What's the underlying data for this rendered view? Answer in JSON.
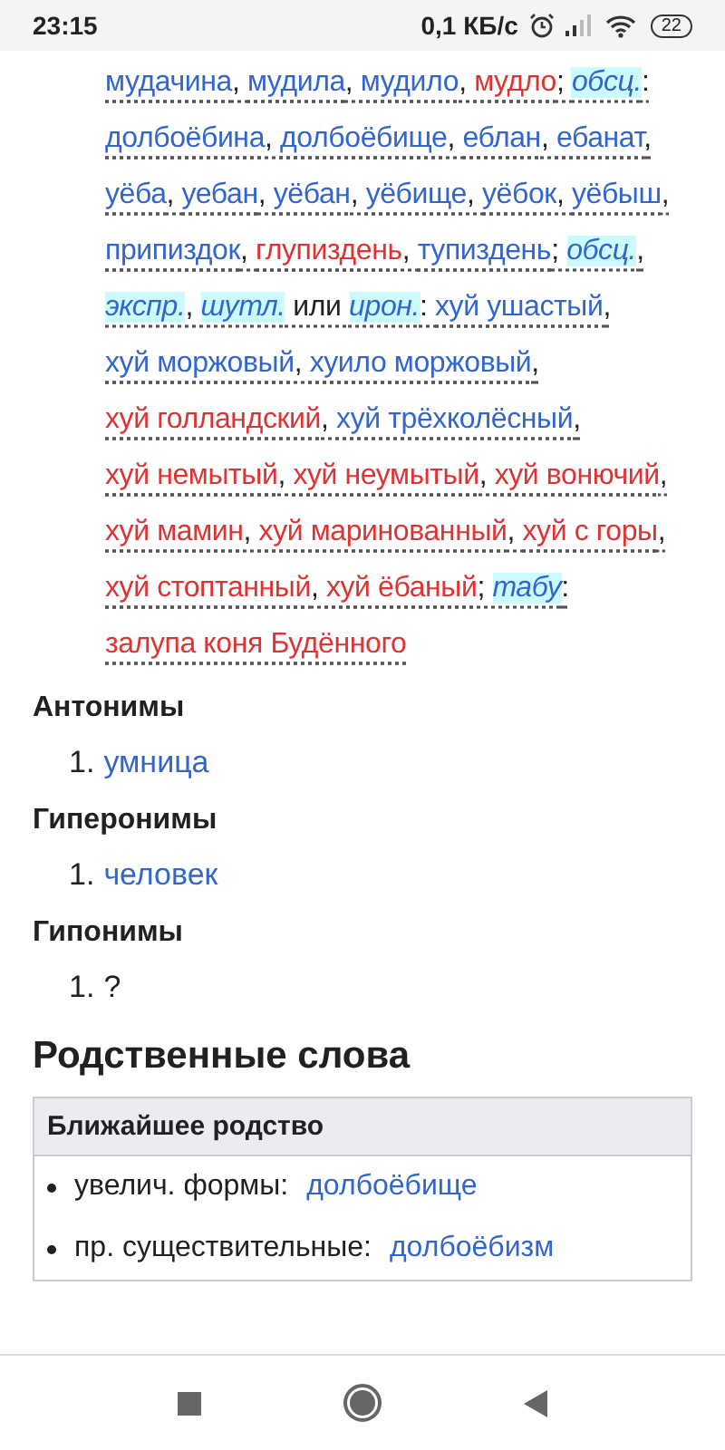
{
  "status_bar": {
    "time": "23:15",
    "speed": "0,1 КБ/с",
    "battery": "22"
  },
  "synonyms": [
    {
      "text": "мудачина",
      "kind": "link"
    },
    {
      "text": ", ",
      "kind": "plain"
    },
    {
      "text": "мудила",
      "kind": "link"
    },
    {
      "text": ", ",
      "kind": "plain"
    },
    {
      "text": "мудило",
      "kind": "link"
    },
    {
      "text": ", ",
      "kind": "plain"
    },
    {
      "text": "мудло",
      "kind": "redlink"
    },
    {
      "text": "; ",
      "kind": "plain"
    },
    {
      "text": "обсц.",
      "kind": "label"
    },
    {
      "text": ": ",
      "kind": "plain"
    },
    {
      "text": "долбоёбина",
      "kind": "link"
    },
    {
      "text": ", ",
      "kind": "plain"
    },
    {
      "text": "долбоёбище",
      "kind": "link"
    },
    {
      "text": ", ",
      "kind": "plain"
    },
    {
      "text": "еблан",
      "kind": "link"
    },
    {
      "text": ", ",
      "kind": "plain"
    },
    {
      "text": "ебанат",
      "kind": "link"
    },
    {
      "text": ", ",
      "kind": "plain"
    },
    {
      "text": "уёба",
      "kind": "link"
    },
    {
      "text": ", ",
      "kind": "plain"
    },
    {
      "text": "уебан",
      "kind": "link"
    },
    {
      "text": ", ",
      "kind": "plain"
    },
    {
      "text": "уёбан",
      "kind": "link"
    },
    {
      "text": ", ",
      "kind": "plain"
    },
    {
      "text": "уёбище",
      "kind": "link"
    },
    {
      "text": ", ",
      "kind": "plain"
    },
    {
      "text": "уёбок",
      "kind": "link"
    },
    {
      "text": ", ",
      "kind": "plain"
    },
    {
      "text": "уёбыш",
      "kind": "link"
    },
    {
      "text": ", ",
      "kind": "plain"
    },
    {
      "text": "припиздок",
      "kind": "link"
    },
    {
      "text": ", ",
      "kind": "plain"
    },
    {
      "text": "глупиздень",
      "kind": "redlink"
    },
    {
      "text": ", ",
      "kind": "plain"
    },
    {
      "text": "тупиздень",
      "kind": "link"
    },
    {
      "text": "; ",
      "kind": "plain"
    },
    {
      "text": "обсц.",
      "kind": "label"
    },
    {
      "text": ", ",
      "kind": "plain"
    },
    {
      "text": "экспр.",
      "kind": "label"
    },
    {
      "text": ", ",
      "kind": "plain"
    },
    {
      "text": "шутл.",
      "kind": "label"
    },
    {
      "text": " или ",
      "kind": "plain"
    },
    {
      "text": "ирон.",
      "kind": "label"
    },
    {
      "text": ": ",
      "kind": "plain"
    },
    {
      "text": "хуй ушастый",
      "kind": "link"
    },
    {
      "text": ", ",
      "kind": "plain"
    },
    {
      "text": "хуй моржовый",
      "kind": "link"
    },
    {
      "text": ", ",
      "kind": "plain"
    },
    {
      "text": "хуило моржовый",
      "kind": "link"
    },
    {
      "text": ", ",
      "kind": "plain"
    },
    {
      "text": "хуй голландский",
      "kind": "redlink"
    },
    {
      "text": ", ",
      "kind": "plain"
    },
    {
      "text": "хуй трёхколёсный",
      "kind": "link"
    },
    {
      "text": ", ",
      "kind": "plain"
    },
    {
      "text": "хуй немытый",
      "kind": "redlink"
    },
    {
      "text": ", ",
      "kind": "plain"
    },
    {
      "text": "хуй неумытый",
      "kind": "redlink"
    },
    {
      "text": ", ",
      "kind": "plain"
    },
    {
      "text": "хуй вонючий",
      "kind": "redlink"
    },
    {
      "text": ", ",
      "kind": "plain"
    },
    {
      "text": "хуй мамин",
      "kind": "redlink"
    },
    {
      "text": ", ",
      "kind": "plain"
    },
    {
      "text": "хуй маринованный",
      "kind": "redlink"
    },
    {
      "text": ", ",
      "kind": "plain"
    },
    {
      "text": "хуй с горы",
      "kind": "redlink"
    },
    {
      "text": ", ",
      "kind": "plain"
    },
    {
      "text": "хуй стоптанный",
      "kind": "redlink"
    },
    {
      "text": ", ",
      "kind": "plain"
    },
    {
      "text": "хуй ёбаный",
      "kind": "redlink"
    },
    {
      "text": "; ",
      "kind": "plain"
    },
    {
      "text": "табу",
      "kind": "label"
    },
    {
      "text": ": ",
      "kind": "plain"
    },
    {
      "text": "залупа коня Будённого",
      "kind": "redlink"
    }
  ],
  "sections": [
    {
      "heading": "Антонимы",
      "items": [
        {
          "number": "1.",
          "text": "умница",
          "kind": "link"
        }
      ]
    },
    {
      "heading": "Гиперонимы",
      "items": [
        {
          "number": "1.",
          "text": "человек",
          "kind": "link"
        }
      ]
    },
    {
      "heading": "Гипонимы",
      "items": [
        {
          "number": "1.",
          "text": "?",
          "kind": "plain"
        }
      ]
    }
  ],
  "related": {
    "heading": "Родственные слова",
    "table_header": "Ближайшее родство",
    "rows": [
      {
        "label": "увелич. формы:",
        "link": "долбоёбище"
      },
      {
        "label": "пр. существительные:",
        "link": "долбоёбизм"
      }
    ]
  }
}
